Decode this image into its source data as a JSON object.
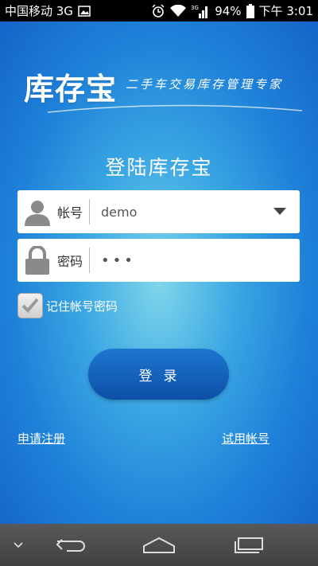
{
  "status_bar": {
    "carrier": "中国移动 3G",
    "battery": "94%",
    "time": "下午 3:01",
    "icons": [
      "image-icon",
      "alarm-icon",
      "wifi-icon",
      "signal-3g-icon",
      "battery-icon"
    ]
  },
  "header": {
    "logo": "库存宝",
    "slogan": "二手车交易库存管理专家"
  },
  "login": {
    "title": "登陆库存宝",
    "account_label": "帐号",
    "account_value": "demo",
    "password_label": "密码",
    "password_value": "•••",
    "remember_label": "记住帐号密码",
    "remember_checked": true,
    "login_button": "登录",
    "register_link": "申请注册",
    "trial_link": "试用帐号"
  },
  "nav_bar": {
    "icons": [
      "chevron-down-icon",
      "back-icon",
      "home-icon",
      "recents-icon"
    ]
  },
  "colors": {
    "background_center": "#7fd6ea",
    "background_edge": "#1464c7",
    "button": "#0d4fa6"
  }
}
